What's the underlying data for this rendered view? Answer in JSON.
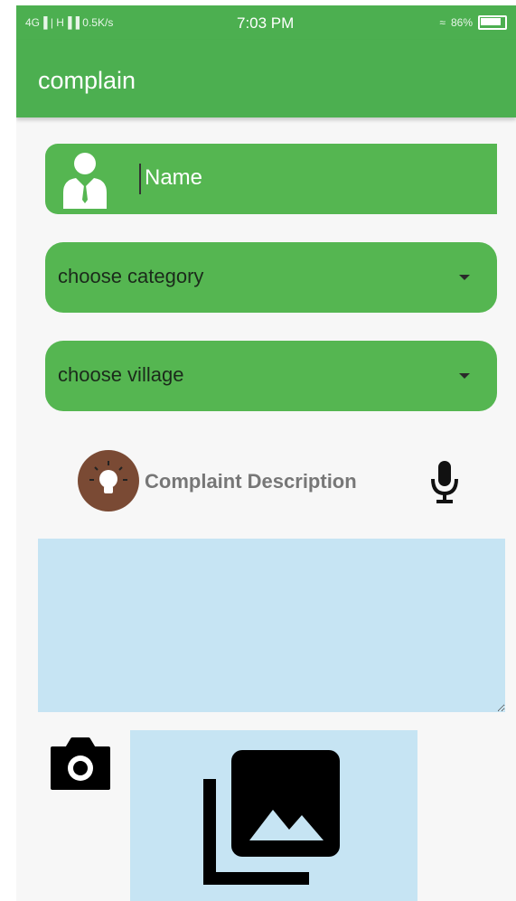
{
  "status_bar": {
    "network_left": "4G▐ | H▐▐ 0.5K/s",
    "time": "7:03 PM",
    "battery": "86%"
  },
  "app_bar": {
    "title": "complain"
  },
  "form": {
    "name_placeholder": "Name",
    "category_label": "choose category",
    "village_label": "choose village",
    "description_label": "Complaint Description",
    "description_value": ""
  },
  "icons": {
    "user": "person-icon",
    "dropdown": "caret-down-icon",
    "bulb": "lightbulb-icon",
    "mic": "microphone-icon",
    "camera": "camera-icon",
    "gallery": "gallery-icon"
  },
  "colors": {
    "primary": "#4caf50",
    "field": "#55b651",
    "input_bg": "#c6e4f3",
    "bulb_bg": "#7a4a34"
  }
}
